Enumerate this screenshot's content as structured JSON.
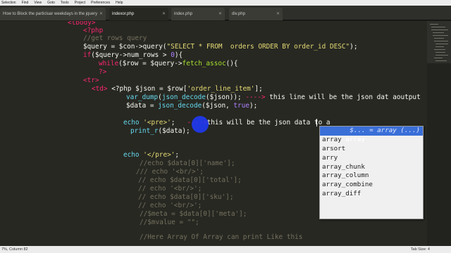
{
  "menu": [
    "Selection",
    "Find",
    "View",
    "Goto",
    "Tools",
    "Project",
    "Preferences",
    "Help"
  ],
  "tabs": [
    {
      "label": "How to Block the particluar weekdays in the jquery",
      "active": false
    },
    {
      "label": "indexor.php",
      "active": true
    },
    {
      "label": "index.php",
      "active": false
    },
    {
      "label": "div.php",
      "active": false
    }
  ],
  "code": {
    "l1": "<tbody>",
    "l2": "<?php",
    "l3": "//get rows query",
    "l4a": "$query = $con->query(",
    "l4b": "\"SELECT * FROM  orders ORDER BY order_id DESC\"",
    "l4c": ");",
    "l5a": "if",
    "l5b": "($query->num_rows > ",
    "l5c": "0",
    "l5d": "){",
    "l6a": "while",
    "l6b": "($row = $query->",
    "l6c": "fetch_assoc",
    "l6d": "(){",
    "l7": "?>",
    "l8": "<tr>",
    "l9a": "<td>",
    "l9b": " <?php $json = $row[",
    "l9c": "'order_line_item'",
    "l9d": "];",
    "l10a": "var_dump",
    "l10b": "(",
    "l10c": "json_decode",
    "l10d": "($json)); ",
    "l10e": "---->",
    "l10f": " this line will be the json dat aoutput",
    "l11a": "$data = ",
    "l11b": "json_decode",
    "l11c": "($json, ",
    "l11d": "true",
    "l11e": ");",
    "l12a": "echo ",
    "l12b": "'<pre>'",
    "l12c": ";   ",
    "l12d": "---->",
    "l12e": "this will be the json data to a",
    "l13a": "print_r",
    "l13b": "($data);",
    "l14a": "echo ",
    "l14b": "'</pre>'",
    "l14c": ";",
    "l15": "//echo $data[0]['name'];",
    "l16": "/// echo '<br/>';",
    "l17": "// echo $data[0]['total'];",
    "l18": "// echo '<br/>';",
    "l19": "// echo $data[0]['sku'];",
    "l20": "// echo '<br/>';",
    "l21": "//$meta = $data[0]['meta'];",
    "l22": "//$mvalue = \"\";",
    "l23": "//Here Array Of Array can print Like this"
  },
  "autocomplete": {
    "items": [
      "array",
      "array",
      "arsort",
      "arry",
      "array_chunk",
      "array_column",
      "array_combine",
      "array_diff"
    ],
    "selected_hint": "$... = array (...)"
  },
  "status": {
    "left": "7%, Column 82",
    "right": "Tab Size: 4"
  }
}
